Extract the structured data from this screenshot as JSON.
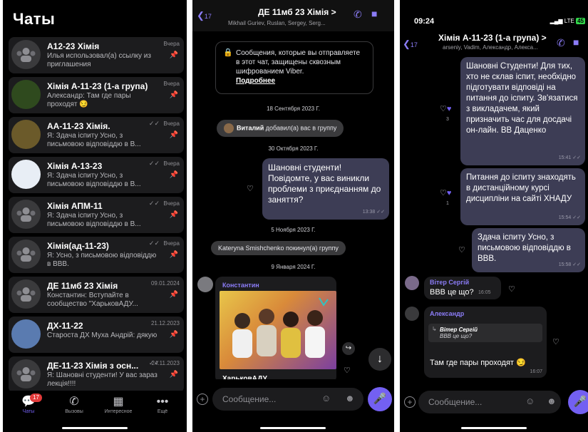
{
  "chats_screen": {
    "title": "Чаты",
    "chats": [
      {
        "name": "А12-23 Хімія",
        "preview": "Илья использовал(а) ссылку из приглашения",
        "date": "Вчера",
        "avatar": "group-placeholder",
        "read_ticks": false
      },
      {
        "name": "Хімія А-11-23 (1-а група)",
        "preview": "Александр: Там где пары проходят 😏",
        "date": "Вчера",
        "avatar": "breaking-bad-logo",
        "read_ticks": false
      },
      {
        "name": "АА-11-23 Хімія.",
        "preview": "Я: Здача іспиту Усно, з письмовою відповіддю в В...",
        "date": "Вчера",
        "avatar": "photo-people",
        "read_ticks": true
      },
      {
        "name": "Хімія А-13-23",
        "preview": "Я: Здача іспиту Усно, з письмовою відповіддю в В...",
        "date": "Вчера",
        "avatar": "book-logo",
        "read_ticks": true
      },
      {
        "name": "Хімія АПМ-11",
        "preview": "Я: Здача іспиту Усно, з письмовою відповіддю в В...",
        "date": "Вчера",
        "avatar": "group-placeholder",
        "read_ticks": true
      },
      {
        "name": "Хімія(ад-11-23)",
        "preview": "Я: Усно, з письмовою відповіддю в ВВВ.",
        "date": "Вчера",
        "avatar": "group-placeholder",
        "read_ticks": true
      },
      {
        "name": "ДЕ 11мб 23 Хімія",
        "preview": "Константин: Вступайте в сообщество \"ХарьковАДУ...",
        "date": "09.01.2024",
        "avatar": "group-placeholder",
        "read_ticks": false
      },
      {
        "name": "ДХ-11-22",
        "preview": "Староста ДХ Муха Андрій: дякую",
        "date": "21.12.2023",
        "avatar": "field-photo",
        "read_ticks": false
      },
      {
        "name": "ДЕ-11-23 Хімія з осн...",
        "preview": "Я: Шановні студенти! У вас зараз лекція!!!!",
        "date": "24.11.2023",
        "avatar": "group-placeholder",
        "read_ticks": true
      }
    ],
    "tabs": [
      {
        "label": "Чаты",
        "icon": "chat-bubble-icon",
        "badge": "17",
        "active": true
      },
      {
        "label": "Вызовы",
        "icon": "phone-icon",
        "active": false
      },
      {
        "label": "Интересное",
        "icon": "explore-icon",
        "active": false
      },
      {
        "label": "Ещё",
        "icon": "more-icon",
        "active": false
      }
    ]
  },
  "chat2": {
    "back_count": "17",
    "title": "ДЕ 11мб 23 Хімія >",
    "subtitle": "Mikhail Guriev, Ruslan, Sergey, Serg...",
    "e2e_text": "Сообщения, которые вы отправляете в этот чат, защищены сквозным шифрованием Viber.",
    "e2e_link": "Подробнее",
    "dates": [
      "18 Сентября 2023 Г.",
      "30 Октября 2023 Г.",
      "5 Ноября 2023 Г.",
      "9 Января 2024 Г."
    ],
    "sys_added_name": "Виталий",
    "sys_added_rest": "добавил(а) вас в группу",
    "sys_left": "Kateryna Smishchenko покинул(а) группу",
    "out_message": "Шановні студенти! Повідомте, у вас виникли проблеми з приєднанням до заняття?",
    "out_time": "13:38",
    "in_sender": "Константин",
    "in_caption": "ХарьковАДУ",
    "composer_placeholder": "Сообщение..."
  },
  "chat3": {
    "status_time": "09:24",
    "status_net": "LTE",
    "battery": "45",
    "back_count": "17",
    "title": "Хімія А-11-23 (1-а група) >",
    "subtitle": "arseniy, Vadim, Александр, Алекса...",
    "msg1": "Шановні Студенти! Для тих, хто не склав іспит, необхідно підготувати відповіді на питання до іспиту. Зв'язатися з викладачем, який призначить час для досдачі он-лайн. ВВ Даценко",
    "msg1_time": "15:41",
    "msg1_reactions": "3",
    "msg2": "Питання до іспиту знаходять в дистанційному курсі дисципліни на сайті ХНАДУ",
    "msg2_time": "15:54",
    "msg2_reactions": "1",
    "msg3": "Здача іспиту Усно, з письмовою відповіддю в ВВВ.",
    "msg3_time": "15:58",
    "in1_sender": "Вітер Сергій",
    "in1_text": "ВВВ це що?",
    "in1_time": "16:05",
    "in2_sender": "Александр",
    "in2_quote_name": "Вітер Сергій",
    "in2_quote_text": "ВВВ це що?",
    "in2_text": "Там где пары проходят 😏",
    "in2_time": "16:07",
    "composer_placeholder": "Сообщение..."
  },
  "colors": {
    "accent": "#7360f2",
    "bubble_out": "#3d3d55",
    "bubble_in": "#1c1c1e"
  }
}
